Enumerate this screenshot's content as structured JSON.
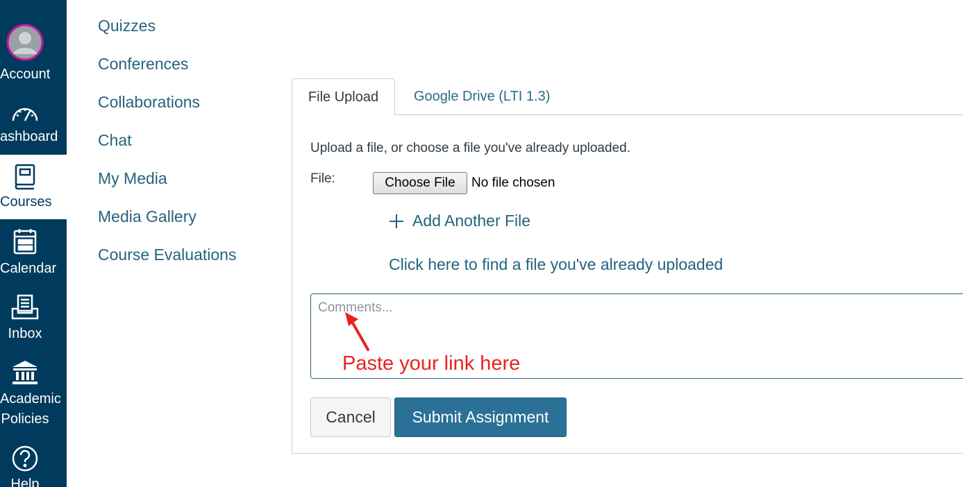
{
  "global_nav": {
    "items": [
      {
        "label": "Account",
        "icon": "avatar-icon"
      },
      {
        "label": "ashboard",
        "icon": "dashboard-icon"
      },
      {
        "label": "Courses",
        "icon": "courses-icon",
        "active": true
      },
      {
        "label": "Calendar",
        "icon": "calendar-icon"
      },
      {
        "label": "Inbox",
        "icon": "inbox-icon"
      },
      {
        "label": "Academic Policies",
        "label_lines": [
          "Academic",
          "Policies"
        ],
        "icon": "institution-icon"
      },
      {
        "label": "Help",
        "icon": "help-icon"
      }
    ],
    "colors": {
      "background": "#003a5d",
      "active_background": "#ffffff",
      "avatar_ring": "#c3169a"
    }
  },
  "course_nav": {
    "links": [
      "Quizzes",
      "Conferences",
      "Collaborations",
      "Chat",
      "My Media",
      "Media Gallery",
      "Course Evaluations"
    ]
  },
  "submission": {
    "tabs": [
      {
        "label": "File Upload",
        "active": true
      },
      {
        "label": "Google Drive (LTI 1.3)",
        "active": false
      }
    ],
    "instructions": "Upload a file, or choose a file you've already uploaded.",
    "file_label": "File:",
    "choose_file_label": "Choose File",
    "no_file_text": "No file chosen",
    "add_another_label": "Add Another File",
    "find_uploaded_label": "Click here to find a file you've already uploaded",
    "comments_placeholder": "Comments...",
    "cancel_label": "Cancel",
    "submit_label": "Submit Assignment"
  },
  "annotation": {
    "text": "Paste your link here",
    "color": "#e8231f"
  }
}
